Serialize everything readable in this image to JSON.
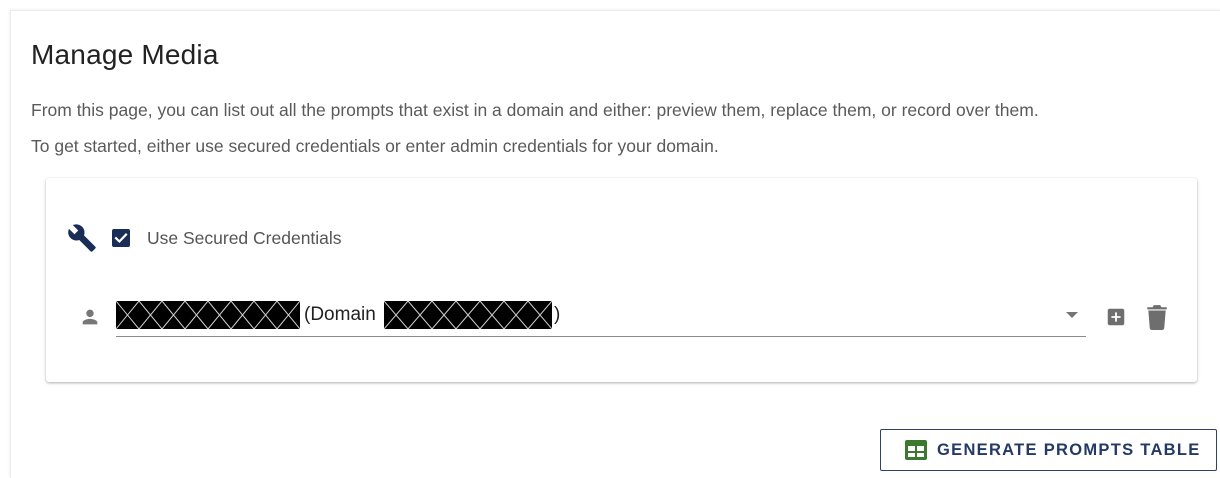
{
  "page": {
    "title": "Manage Media",
    "description_line1": "From this page, you can list out all the prompts that exist in a domain and either: preview them, replace them, or record over them.",
    "description_line2": "To get started, either use secured credentials or enter admin credentials for your domain."
  },
  "credentials": {
    "settings_icon": "wrench-icon",
    "use_secured_checked": true,
    "use_secured_label": "Use Secured Credentials",
    "account_icon": "person-icon",
    "selected_prefix": "(Domain",
    "selected_suffix": ")",
    "add_icon": "add-box-icon",
    "delete_icon": "trash-icon"
  },
  "actions": {
    "generate_label": "GENERATE PROMPTS TABLE",
    "generate_icon": "table-icon"
  },
  "colors": {
    "primary": "#1a2d56",
    "button_text": "#233a66",
    "table_icon": "#3b7a2e"
  }
}
